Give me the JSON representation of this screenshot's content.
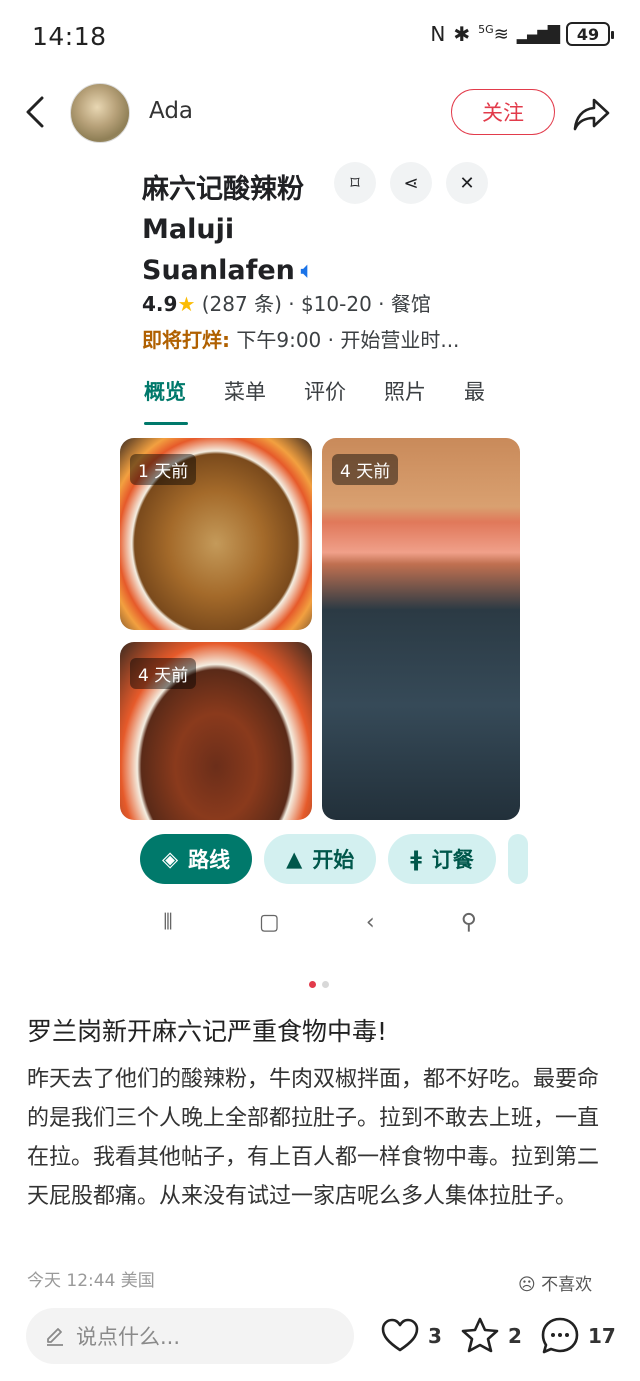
{
  "status_bar": {
    "time": "14:18",
    "network_label": "5G",
    "battery": "49"
  },
  "header": {
    "username": "Ada",
    "follow_label": "关注"
  },
  "map_card": {
    "title": "麻六记酸辣粉 Maluji Suanlafen",
    "rating": "4.9",
    "review_count": "(287 条)",
    "price_category": "· $10-20 · 餐馆",
    "status_label": "即将打烊:",
    "hours_text": "下午9:00 · 开始营业时...",
    "tabs": [
      "概览",
      "菜单",
      "评价",
      "照片",
      "最"
    ],
    "photos": [
      {
        "badge": "1 天前"
      },
      {
        "badge": "4 天前"
      },
      {
        "badge": "4 天前"
      }
    ],
    "actions": {
      "directions": "路线",
      "start": "开始",
      "reserve": "订餐"
    }
  },
  "post": {
    "title": "罗兰岗新开麻六记严重食物中毒!",
    "body": "昨天去了他们的酸辣粉，牛肉双椒拌面，都不好吃。最要命的是我们三个人晚上全部都拉肚子。拉到不敢去上班，一直在拉。我看其他帖子，有上百人都一样食物中毒。拉到第二天屁股都痛。从来没有试过一家店呢么多人集体拉肚子。",
    "meta": "今天 12:44 美国",
    "dislike_label": "不喜欢"
  },
  "bottom_bar": {
    "comment_placeholder": "说点什么...",
    "likes": "3",
    "favorites": "2",
    "comments": "17"
  },
  "colors": {
    "accent_red": "#e23b4b",
    "maps_teal": "#00796b"
  }
}
